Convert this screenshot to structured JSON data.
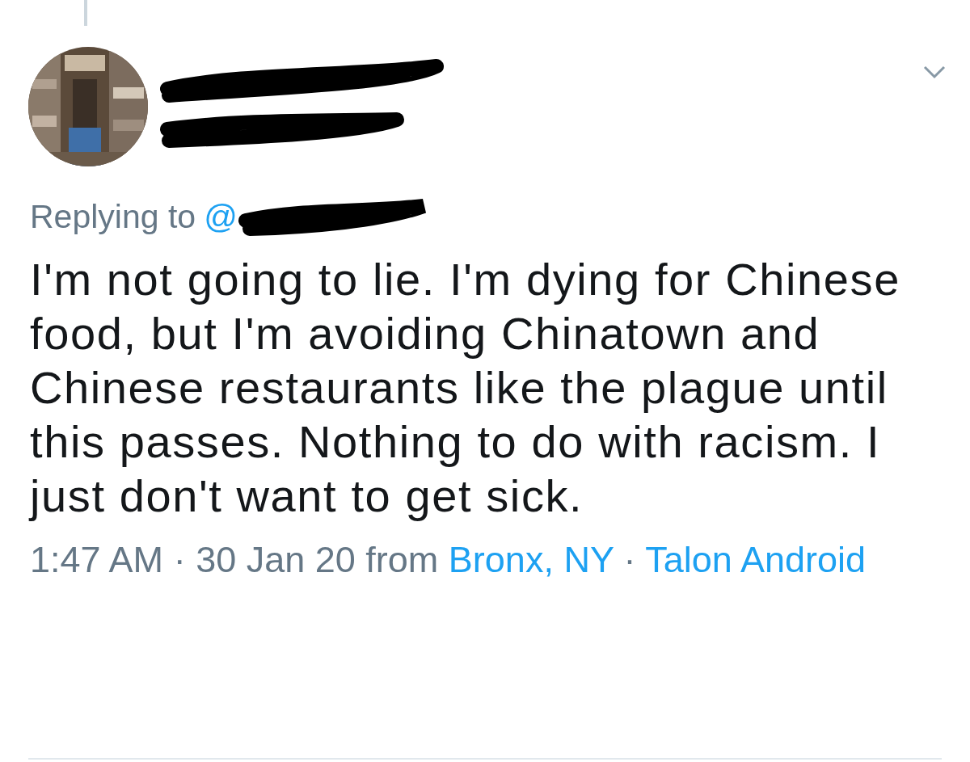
{
  "tweet": {
    "replying_to": {
      "label": "Replying to",
      "handle": "@"
    },
    "text": "I'm not going to lie. I'm dying for Chinese food, but I'm avoiding Chinatown and Chinese restaurants like the plague until this passes. Nothing to do with racism. I just don't want to get sick.",
    "footer": {
      "time": "1:47 AM",
      "separator_1": "·",
      "date_prefix": "30 Jan 20 from",
      "location": "Bronx, NY",
      "separator_2": "·",
      "client": "Talon Android"
    }
  }
}
